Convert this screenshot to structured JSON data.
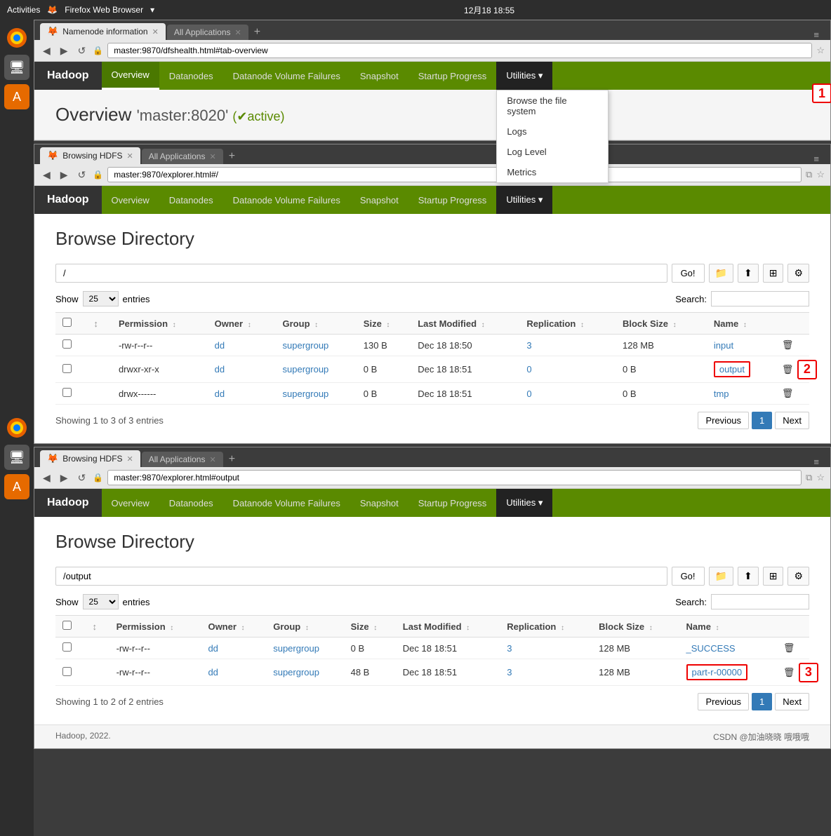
{
  "os": {
    "taskbar": {
      "activities": "Activities",
      "browser_name": "Firefox Web Browser",
      "time": "12月18 18:55"
    }
  },
  "browser1": {
    "tabs": [
      {
        "label": "Namenode information",
        "active": true
      },
      {
        "label": "All Applications",
        "active": false
      }
    ],
    "url": "master:9870/dfshealth.html#tab-overview",
    "nav": {
      "brand": "Hadoop",
      "items": [
        "Overview",
        "Datanodes",
        "Datanode Volume Failures",
        "Snapshot",
        "Startup Progress",
        "Utilities ▾"
      ]
    },
    "dropdown": {
      "items": [
        "Browse the file system",
        "Logs",
        "Log Level",
        "Metrics"
      ]
    },
    "overview": {
      "title": "Overview",
      "host": "'master:8020'",
      "badge": "✔active"
    }
  },
  "browser2": {
    "tabs": [
      {
        "label": "Browsing HDFS",
        "active": true
      },
      {
        "label": "All Applications",
        "active": false
      }
    ],
    "url": "master:9870/explorer.html#/",
    "nav": {
      "brand": "Hadoop",
      "items": [
        "Overview",
        "Datanodes",
        "Datanode Volume Failures",
        "Snapshot",
        "Startup Progress",
        "Utilities ▾"
      ]
    },
    "page_title": "Browse Directory",
    "path": "/",
    "go_btn": "Go!",
    "show_label": "Show",
    "entries_label": "entries",
    "entries_value": "25",
    "search_label": "Search:",
    "table": {
      "headers": [
        "",
        "",
        "Permission",
        "",
        "Owner",
        "",
        "Group",
        "",
        "Size",
        "",
        "Last Modified",
        "",
        "Replication",
        "",
        "Block Size",
        "",
        "Name",
        ""
      ],
      "rows": [
        {
          "checkbox": "",
          "permission": "-rw-r--r--",
          "owner": "dd",
          "group": "supergroup",
          "size": "130 B",
          "modified": "Dec 18 18:50",
          "replication": "3",
          "block_size": "128 MB",
          "name": "input",
          "name_link": true,
          "highlighted": false
        },
        {
          "checkbox": "",
          "permission": "drwxr-xr-x",
          "owner": "dd",
          "group": "supergroup",
          "size": "0 B",
          "modified": "Dec 18 18:51",
          "replication": "0",
          "block_size": "0 B",
          "name": "output",
          "name_link": true,
          "highlighted": true
        },
        {
          "checkbox": "",
          "permission": "drwx------",
          "owner": "dd",
          "group": "supergroup",
          "size": "0 B",
          "modified": "Dec 18 18:51",
          "replication": "0",
          "block_size": "0 B",
          "name": "tmp",
          "name_link": true,
          "highlighted": false
        }
      ]
    },
    "showing_text": "Showing 1 to 3 of 3 entries",
    "prev_btn": "Previous",
    "page_num": "1",
    "next_btn": "Next"
  },
  "browser3": {
    "tabs": [
      {
        "label": "Browsing HDFS",
        "active": true
      },
      {
        "label": "All Applications",
        "active": false
      }
    ],
    "url": "master:9870/explorer.html#output",
    "nav": {
      "brand": "Hadoop",
      "items": [
        "Overview",
        "Datanodes",
        "Datanode Volume Failures",
        "Snapshot",
        "Startup Progress",
        "Utilities ▾"
      ]
    },
    "page_title": "Browse Directory",
    "path": "/output",
    "go_btn": "Go!",
    "show_label": "Show",
    "entries_label": "entries",
    "entries_value": "25",
    "search_label": "Search:",
    "table": {
      "headers": [
        "",
        "",
        "Permission",
        "",
        "Owner",
        "",
        "Group",
        "",
        "Size",
        "",
        "Last Modified",
        "",
        "Replication",
        "",
        "Block Size",
        "",
        "Name",
        ""
      ],
      "rows": [
        {
          "checkbox": "",
          "permission": "-rw-r--r--",
          "owner": "dd",
          "group": "supergroup",
          "size": "0 B",
          "modified": "Dec 18 18:51",
          "replication": "3",
          "block_size": "128 MB",
          "name": "_SUCCESS",
          "name_link": true,
          "highlighted": false
        },
        {
          "checkbox": "",
          "permission": "-rw-r--r--",
          "owner": "dd",
          "group": "supergroup",
          "size": "48 B",
          "modified": "Dec 18 18:51",
          "replication": "3",
          "block_size": "128 MB",
          "name": "part-r-00000",
          "name_link": true,
          "highlighted": true
        }
      ]
    },
    "showing_text": "Showing 1 to 2 of 2 entries",
    "prev_btn": "Previous",
    "page_num": "1",
    "next_btn": "Next"
  },
  "footer": {
    "left": "Hadoop, 2022.",
    "right": "CSDN @加油晓晓 哦哦哦"
  },
  "annotations": {
    "a1": "1",
    "a2": "2",
    "a3": "3"
  }
}
